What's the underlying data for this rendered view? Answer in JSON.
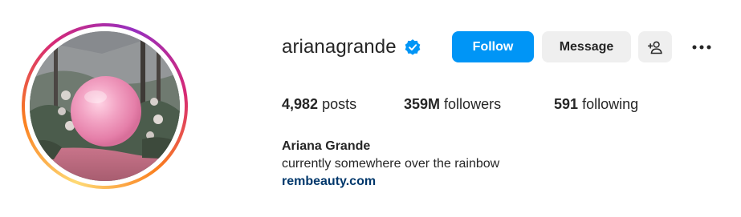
{
  "profile": {
    "username": "arianagrande",
    "verified": true,
    "verified_icon": "verified-badge-icon",
    "full_name": "Ariana Grande",
    "bio": "currently somewhere over the rainbow",
    "link": "rembeauty.com"
  },
  "actions": {
    "follow_label": "Follow",
    "message_label": "Message",
    "suggest_icon": "add-person-icon",
    "more_icon": "more-options-icon"
  },
  "stats": {
    "posts_count": "4,982",
    "posts_label": "posts",
    "followers_count": "359M",
    "followers_label": "followers",
    "following_count": "591",
    "following_label": "following"
  },
  "colors": {
    "primary_blue": "#0095f6",
    "secondary_button": "#efefef",
    "link_blue": "#00376b",
    "text": "#262626"
  }
}
